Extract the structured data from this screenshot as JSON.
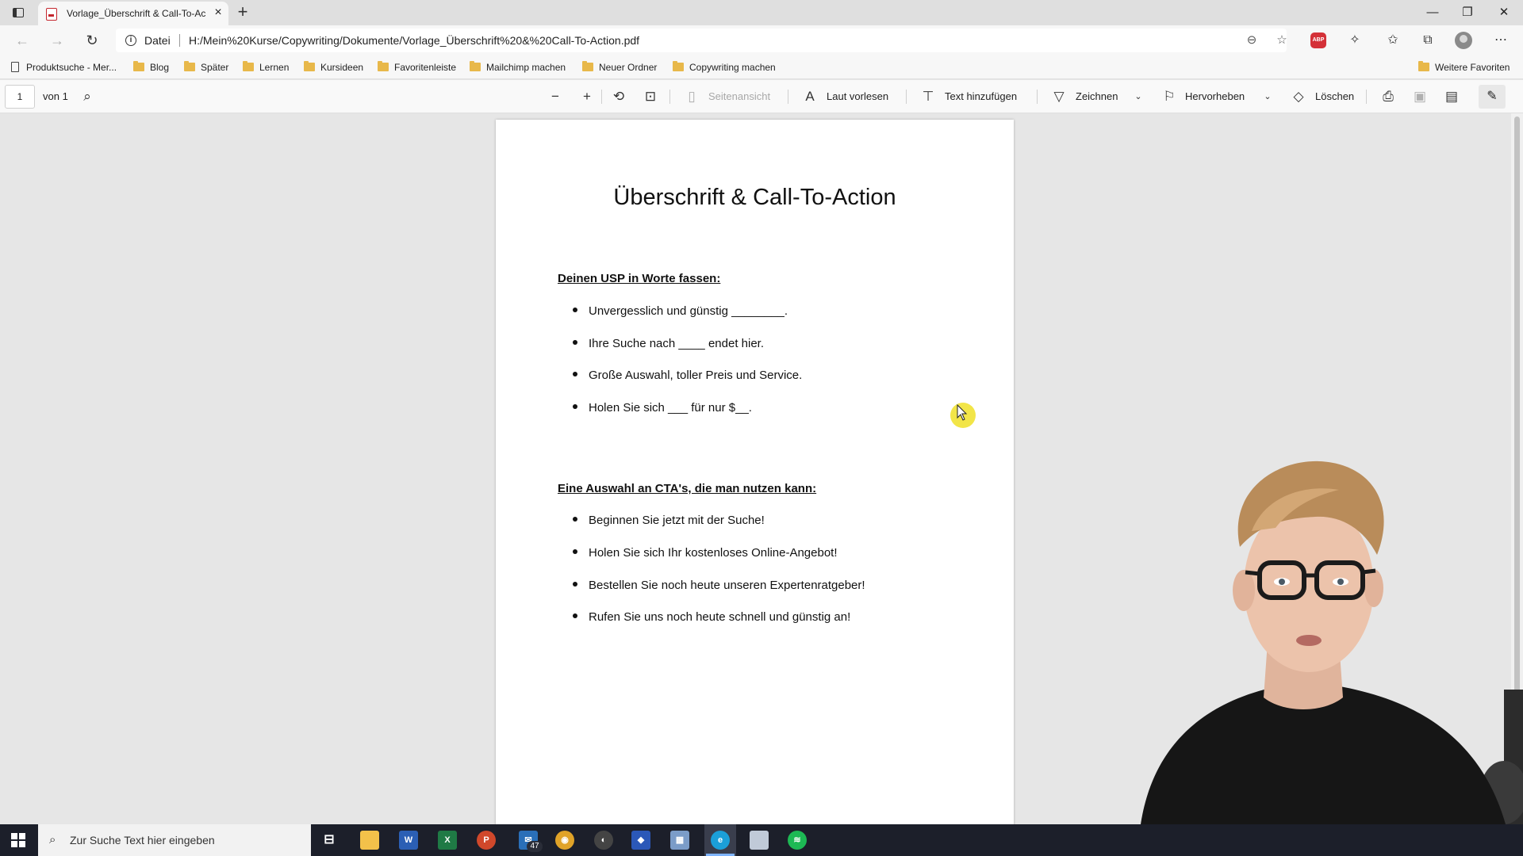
{
  "browser": {
    "tab_title": "Vorlage_Überschrift & Call-To-Ac",
    "new_tab": "+",
    "window_controls": {
      "minimize": "—",
      "maximize": "❐",
      "close": "✕"
    },
    "address": {
      "scheme_label": "Datei",
      "url": "H:/Mein%20Kurse/Copywriting/Dokumente/Vorlage_Überschrift%20&%20Call-To-Action.pdf"
    },
    "favorites": [
      {
        "label": "Produktsuche - Mer...",
        "icon": "page-icon"
      },
      {
        "label": "Blog",
        "icon": "folder-icon"
      },
      {
        "label": "Später",
        "icon": "folder-icon"
      },
      {
        "label": "Lernen",
        "icon": "folder-icon"
      },
      {
        "label": "Kursideen",
        "icon": "folder-icon"
      },
      {
        "label": "Favoritenleiste",
        "icon": "folder-icon"
      },
      {
        "label": "Mailchimp machen",
        "icon": "folder-icon"
      },
      {
        "label": "Neuer Ordner",
        "icon": "folder-icon"
      },
      {
        "label": "Copywriting machen",
        "icon": "folder-icon"
      }
    ],
    "other_favorites": "Weitere Favoriten",
    "abp_label": "ABP"
  },
  "pdf_toolbar": {
    "page_number": "1",
    "page_of": "von 1",
    "page_view": "Seitenansicht",
    "read_aloud": "Laut vorlesen",
    "add_text": "Text hinzufügen",
    "draw": "Zeichnen",
    "highlight": "Hervorheben",
    "erase": "Löschen"
  },
  "document": {
    "title": "Überschrift & Call-To-Action",
    "section1": {
      "heading": "Deinen USP in Worte fassen:",
      "items": [
        "Unvergesslich und günstig ________.",
        "Ihre Suche nach ____ endet hier.",
        "Große Auswahl, toller Preis und Service.",
        "Holen Sie sich ___ für nur $__."
      ]
    },
    "section2": {
      "heading": "Eine Auswahl an CTA's, die man nutzen kann:",
      "items": [
        "Beginnen Sie jetzt mit der Suche!",
        "Holen Sie sich Ihr kostenloses Online-Angebot!",
        "Bestellen Sie noch heute unseren Expertenratgeber!",
        "Rufen Sie uns noch heute schnell und günstig an!"
      ]
    }
  },
  "taskbar": {
    "search_placeholder": "Zur Suche Text hier eingeben",
    "mail_badge": "47",
    "apps": [
      "task-view-icon",
      "file-explorer-icon",
      "word-icon",
      "excel-icon",
      "powerpoint-icon",
      "mail-icon",
      "chrome-icon",
      "obs-icon",
      "app-icon",
      "app-icon",
      "edge-icon",
      "app-icon",
      "spotify-icon"
    ]
  },
  "colors": {
    "accent_highlight": "#f0e028",
    "abp_red": "#d43138",
    "taskbar": "#1c1f2a"
  }
}
